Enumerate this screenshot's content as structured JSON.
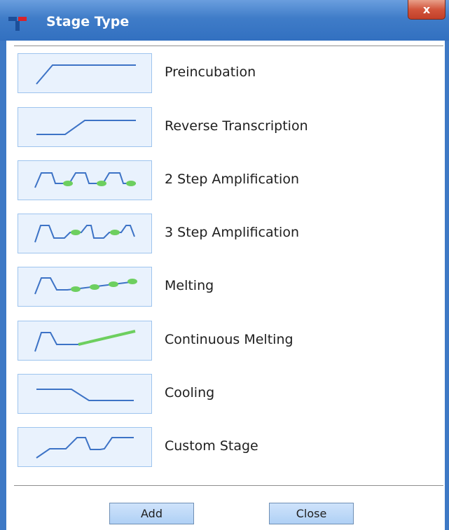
{
  "window": {
    "title": "Stage Type",
    "close_label": "x"
  },
  "stages": [
    {
      "label": "Preincubation",
      "icon": "preincubation-curve-icon"
    },
    {
      "label": "Reverse Transcription",
      "icon": "reverse-transcription-curve-icon"
    },
    {
      "label": "2 Step Amplification",
      "icon": "two-step-amplification-curve-icon"
    },
    {
      "label": "3 Step Amplification",
      "icon": "three-step-amplification-curve-icon"
    },
    {
      "label": "Melting",
      "icon": "melting-curve-icon"
    },
    {
      "label": "Continuous Melting",
      "icon": "continuous-melting-curve-icon"
    },
    {
      "label": "Cooling",
      "icon": "cooling-curve-icon"
    },
    {
      "label": "Custom Stage",
      "icon": "custom-stage-curve-icon"
    }
  ],
  "buttons": {
    "add_label": "Add",
    "close_label": "Close"
  },
  "colors": {
    "titlebar": "#3f7cc8",
    "curve": "#3d73c6",
    "acquisition_point": "#6dcf5f",
    "thumbnail_bg": "#e9f2fd"
  }
}
